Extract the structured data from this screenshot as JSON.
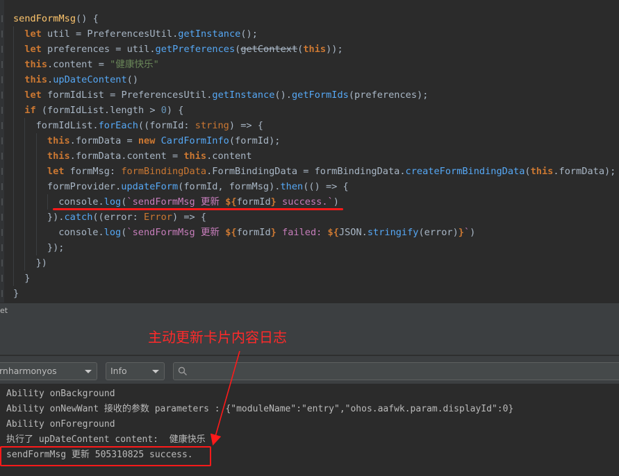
{
  "editor": {
    "lines": [
      {
        "indent": 0,
        "tokens": [
          {
            "t": "sendFormMsg",
            "c": "fn"
          },
          {
            "t": "() {",
            "c": ""
          }
        ]
      },
      {
        "indent": 1,
        "tokens": [
          {
            "t": "let ",
            "c": "kw"
          },
          {
            "t": "util = PreferencesUtil.",
            "c": ""
          },
          {
            "t": "getInstance",
            "c": "call"
          },
          {
            "t": "();",
            "c": ""
          }
        ]
      },
      {
        "indent": 1,
        "tokens": [
          {
            "t": "let ",
            "c": "kw"
          },
          {
            "t": "preferences = util.",
            "c": ""
          },
          {
            "t": "getPreferences",
            "c": "call"
          },
          {
            "t": "(",
            "c": ""
          },
          {
            "t": "getContext",
            "c": "strike"
          },
          {
            "t": "(",
            "c": ""
          },
          {
            "t": "this",
            "c": "kw"
          },
          {
            "t": "));",
            "c": ""
          }
        ]
      },
      {
        "indent": 1,
        "tokens": [
          {
            "t": "this",
            "c": "kw"
          },
          {
            "t": ".content = ",
            "c": ""
          },
          {
            "t": "\"健康快乐\"",
            "c": "str"
          }
        ]
      },
      {
        "indent": 1,
        "tokens": [
          {
            "t": "this",
            "c": "kw"
          },
          {
            "t": ".",
            "c": ""
          },
          {
            "t": "upDateContent",
            "c": "call"
          },
          {
            "t": "()",
            "c": ""
          }
        ]
      },
      {
        "indent": 1,
        "tokens": [
          {
            "t": "let ",
            "c": "kw"
          },
          {
            "t": "formIdList = PreferencesUtil.",
            "c": ""
          },
          {
            "t": "getInstance",
            "c": "call"
          },
          {
            "t": "().",
            "c": ""
          },
          {
            "t": "getFormIds",
            "c": "call"
          },
          {
            "t": "(preferences);",
            "c": ""
          }
        ]
      },
      {
        "indent": 1,
        "tokens": [
          {
            "t": "if ",
            "c": "kw"
          },
          {
            "t": "(formIdList.length > ",
            "c": ""
          },
          {
            "t": "0",
            "c": "num"
          },
          {
            "t": ") {",
            "c": ""
          }
        ]
      },
      {
        "indent": 2,
        "tokens": [
          {
            "t": "formIdList.",
            "c": ""
          },
          {
            "t": "forEach",
            "c": "call"
          },
          {
            "t": "((formId: ",
            "c": ""
          },
          {
            "t": "string",
            "c": "type"
          },
          {
            "t": ") => {",
            "c": ""
          }
        ]
      },
      {
        "indent": 3,
        "tokens": [
          {
            "t": "this",
            "c": "kw"
          },
          {
            "t": ".formData = ",
            "c": ""
          },
          {
            "t": "new ",
            "c": "kw"
          },
          {
            "t": "CardFormInfo",
            "c": "call"
          },
          {
            "t": "(formId);",
            "c": ""
          }
        ]
      },
      {
        "indent": 3,
        "tokens": [
          {
            "t": "this",
            "c": "kw"
          },
          {
            "t": ".formData.content = ",
            "c": ""
          },
          {
            "t": "this",
            "c": "kw"
          },
          {
            "t": ".content",
            "c": ""
          }
        ]
      },
      {
        "indent": 3,
        "tokens": [
          {
            "t": "let ",
            "c": "kw"
          },
          {
            "t": "formMsg: ",
            "c": ""
          },
          {
            "t": "formBindingData",
            "c": "type"
          },
          {
            "t": ".FormBindingData = formBindingData.",
            "c": ""
          },
          {
            "t": "createFormBindingData",
            "c": "call"
          },
          {
            "t": "(",
            "c": ""
          },
          {
            "t": "this",
            "c": "kw"
          },
          {
            "t": ".formData);",
            "c": ""
          }
        ]
      },
      {
        "indent": 3,
        "tokens": [
          {
            "t": "formProvider.",
            "c": ""
          },
          {
            "t": "updateForm",
            "c": "call"
          },
          {
            "t": "(formId, formMsg).",
            "c": ""
          },
          {
            "t": "then",
            "c": "call"
          },
          {
            "t": "(() => {",
            "c": ""
          }
        ]
      },
      {
        "indent": 4,
        "tokens": [
          {
            "t": "console.",
            "c": ""
          },
          {
            "t": "log",
            "c": "call"
          },
          {
            "t": "(",
            "c": ""
          },
          {
            "t": "`sendFormMsg 更新 ",
            "c": "typeName"
          },
          {
            "t": "${",
            "c": "kw"
          },
          {
            "t": "formId",
            "c": ""
          },
          {
            "t": "}",
            "c": "kw"
          },
          {
            "t": " success.`",
            "c": "typeName"
          },
          {
            "t": ")",
            "c": ""
          }
        ]
      },
      {
        "indent": 3,
        "tokens": [
          {
            "t": "}).",
            "c": ""
          },
          {
            "t": "catch",
            "c": "call"
          },
          {
            "t": "((error: ",
            "c": ""
          },
          {
            "t": "Error",
            "c": "type"
          },
          {
            "t": ") => {",
            "c": ""
          }
        ]
      },
      {
        "indent": 4,
        "tokens": [
          {
            "t": "console.",
            "c": ""
          },
          {
            "t": "log",
            "c": "call"
          },
          {
            "t": "(",
            "c": ""
          },
          {
            "t": "`sendFormMsg 更新 ",
            "c": "typeName"
          },
          {
            "t": "${",
            "c": "kw"
          },
          {
            "t": "formId",
            "c": ""
          },
          {
            "t": "}",
            "c": "kw"
          },
          {
            "t": " failed: ",
            "c": "typeName"
          },
          {
            "t": "${",
            "c": "kw"
          },
          {
            "t": "JSON.",
            "c": ""
          },
          {
            "t": "stringify",
            "c": "call"
          },
          {
            "t": "(error)",
            "c": ""
          },
          {
            "t": "}",
            "c": "kw"
          },
          {
            "t": "`",
            "c": "typeName"
          },
          {
            "t": ")",
            "c": ""
          }
        ]
      },
      {
        "indent": 3,
        "tokens": [
          {
            "t": "});",
            "c": ""
          }
        ]
      },
      {
        "indent": 2,
        "tokens": [
          {
            "t": "})",
            "c": ""
          }
        ]
      },
      {
        "indent": 1,
        "tokens": [
          {
            "t": "}",
            "c": ""
          }
        ]
      },
      {
        "indent": 0,
        "tokens": [
          {
            "t": "}",
            "c": ""
          }
        ]
      }
    ]
  },
  "panel": {
    "title": "et",
    "annotation": "主动更新卡片内容日志"
  },
  "filters": {
    "device": "rnharmonyos",
    "level": "Info",
    "search_placeholder": "Q▾"
  },
  "log": {
    "lines": [
      "Ability onBackground",
      "Ability onNewWant 接收的参数 parameters : {\"moduleName\":\"entry\",\"ohos.aafwk.param.displayId\":0}",
      "Ability onForeground",
      "执行了 upDateContent content:  健康快乐",
      "sendFormMsg 更新 505310825 success."
    ]
  },
  "colors": {
    "annotation_red": "#ff1a1a",
    "editor_bg": "#2b2b2b",
    "panel_bg": "#3c3f41"
  }
}
